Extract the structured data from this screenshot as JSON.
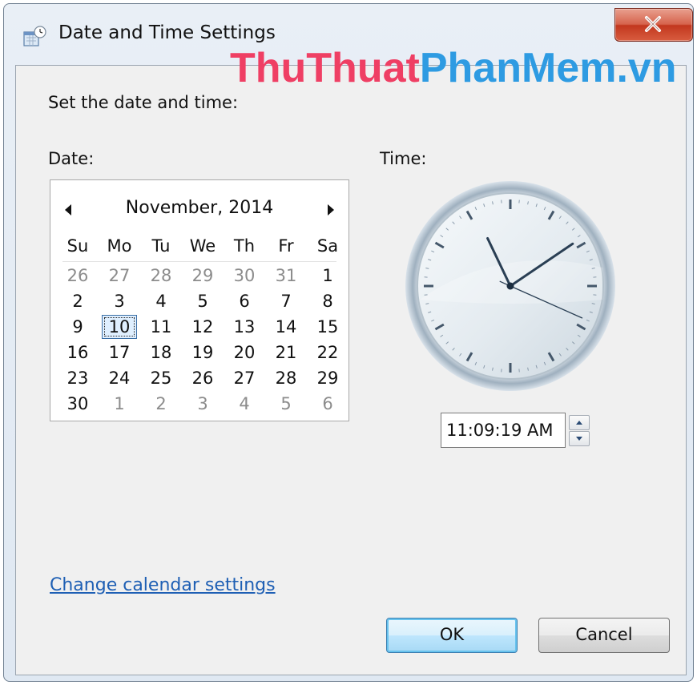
{
  "window": {
    "title": "Date and Time Settings",
    "icons": {
      "app": "calendar-clock-icon",
      "close": "close-icon"
    }
  },
  "watermark": {
    "part1": "ThuThuat",
    "part2": "PhanMem",
    "part3": ".vn"
  },
  "intro_text": "Set the date and time:",
  "date_section": {
    "label": "Date:",
    "month_label": "November, 2014",
    "day_headers": [
      "Su",
      "Mo",
      "Tu",
      "We",
      "Th",
      "Fr",
      "Sa"
    ],
    "weeks": [
      [
        "26",
        "27",
        "28",
        "29",
        "30",
        "31",
        "1"
      ],
      [
        "2",
        "3",
        "4",
        "5",
        "6",
        "7",
        "8"
      ],
      [
        "9",
        "10",
        "11",
        "12",
        "13",
        "14",
        "15"
      ],
      [
        "16",
        "17",
        "18",
        "19",
        "20",
        "21",
        "22"
      ],
      [
        "23",
        "24",
        "25",
        "26",
        "27",
        "28",
        "29"
      ],
      [
        "30",
        "1",
        "2",
        "3",
        "4",
        "5",
        "6"
      ]
    ],
    "selected_day": "10"
  },
  "time_section": {
    "label": "Time:",
    "time_value": "11:09:19 AM",
    "clock": {
      "hour": 11,
      "minute": 9,
      "second": 19
    }
  },
  "link_text": "Change calendar settings",
  "buttons": {
    "ok": "OK",
    "cancel": "Cancel"
  },
  "colors": {
    "link": "#1e5fb4",
    "close_button": "#c9442b",
    "watermark_pink": "#ef3f64",
    "watermark_blue": "#2e9be2"
  }
}
